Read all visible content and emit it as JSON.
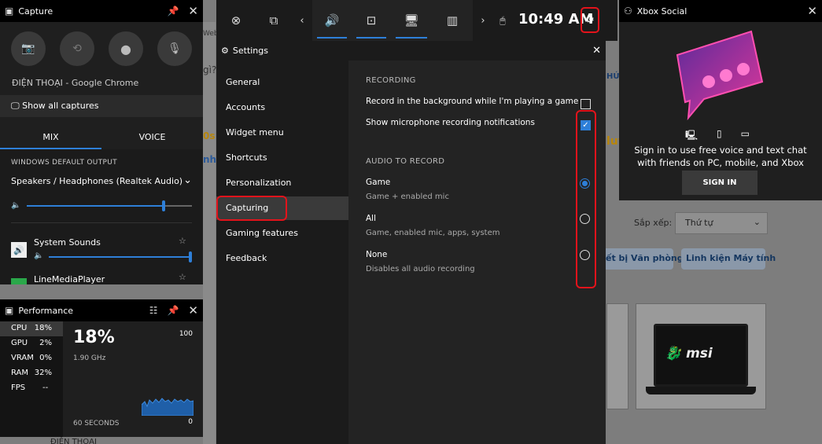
{
  "background": {
    "fragments": [
      "Web",
      "gì?",
      "HỨ",
      "0s",
      "nhậ",
      "luy",
      "ĐIỆN THOẠI"
    ],
    "sort_label": "Sắp xếp:",
    "sort_value": "Thứ tự",
    "pills": [
      "ết bị Văn phòng",
      "Linh kiện Máy tính"
    ],
    "laptop_brand": "msi"
  },
  "capture": {
    "title": "Capture",
    "app_name": "ĐIỆN THOẠI - Google Chrome",
    "show_all": "Show all captures",
    "tabs": [
      "MIX",
      "VOICE"
    ],
    "output_label": "WINDOWS DEFAULT OUTPUT",
    "device": "Speakers / Headphones (Realtek Audio)",
    "master_volume": 0.84,
    "apps": [
      {
        "name": "System Sounds",
        "volume": 1.0
      },
      {
        "name": "LineMediaPlayer",
        "volume": 0.5
      }
    ]
  },
  "performance": {
    "title": "Performance",
    "metrics": [
      {
        "key": "CPU",
        "value": "18%"
      },
      {
        "key": "GPU",
        "value": "2%"
      },
      {
        "key": "VRAM",
        "value": "0%"
      },
      {
        "key": "RAM",
        "value": "32%"
      },
      {
        "key": "FPS",
        "value": "--"
      }
    ],
    "big_value": "18%",
    "sub_value": "1.90 GHz",
    "max_label": "100",
    "min_label": "0",
    "span_label": "60 SECONDS"
  },
  "gamebar": {
    "time": "10:49 AM"
  },
  "settings": {
    "title": "Settings",
    "nav": [
      "General",
      "Accounts",
      "Widget menu",
      "Shortcuts",
      "Personalization",
      "Capturing",
      "Gaming features",
      "Feedback"
    ],
    "active_nav": "Capturing",
    "recording_heading": "RECORDING",
    "options": {
      "background": {
        "label": "Record in the background while I'm playing a game",
        "checked": false
      },
      "mic_notify": {
        "label": "Show microphone recording notifications",
        "checked": true
      }
    },
    "audio_heading": "AUDIO TO RECORD",
    "audio_choices": [
      {
        "label": "Game",
        "desc": "Game + enabled mic",
        "selected": true
      },
      {
        "label": "All",
        "desc": "Game, enabled mic, apps, system",
        "selected": false
      },
      {
        "label": "None",
        "desc": "Disables all audio recording",
        "selected": false
      }
    ]
  },
  "social": {
    "title": "Xbox Social",
    "message_line1": "Sign in to use free voice and text chat",
    "message_line2": "with friends on PC, mobile, and Xbox",
    "signin": "SIGN IN"
  },
  "colors": {
    "accent": "#2e7fd8",
    "highlight": "#e3131b",
    "panel": "#1f1f1f"
  }
}
